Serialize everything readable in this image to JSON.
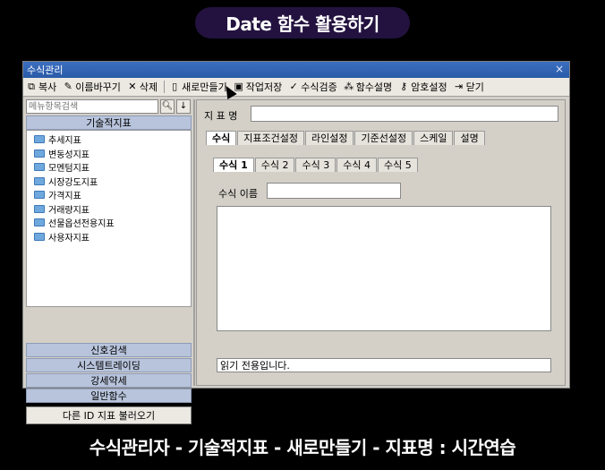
{
  "video": {
    "title": "Date 함수 활용하기",
    "caption": "수식관리자 - 기술적지표 - 새로만들기 - 지표명 : 시간연습"
  },
  "window": {
    "title": "수식관리",
    "close_glyph": "×"
  },
  "toolbar": {
    "items": [
      {
        "label": "복사",
        "icon": "copy-icon"
      },
      {
        "label": "이름바꾸기",
        "icon": "rename-icon"
      },
      {
        "label": "삭제",
        "icon": "delete-icon"
      },
      {
        "label": "새로만들기",
        "icon": "new-doc-icon"
      },
      {
        "label": "작업저장",
        "icon": "save-icon"
      },
      {
        "label": "수식검증",
        "icon": "check-icon"
      },
      {
        "label": "함수설명",
        "icon": "wand-icon"
      },
      {
        "label": "암호설정",
        "icon": "key-icon"
      },
      {
        "label": "닫기",
        "icon": "exit-icon"
      }
    ]
  },
  "left": {
    "search_placeholder": "메뉴항목검색",
    "category": "기술적지표",
    "tree": [
      "추세지표",
      "변동성지표",
      "모멘텀지표",
      "시장강도지표",
      "가격지표",
      "거래량지표",
      "선물옵션전용지표",
      "사용자지표"
    ],
    "groups": [
      "신호검색",
      "시스템트레이딩",
      "강세약세",
      "일반함수"
    ],
    "load_button": "다른 ID 지표 불러오기"
  },
  "right": {
    "name_label": "지 표 명",
    "name_value": "",
    "tabs": [
      "수식",
      "지표조건설정",
      "라인설정",
      "기준선설정",
      "스케일",
      "설명"
    ],
    "formula_tabs": [
      "수식 1",
      "수식 2",
      "수식 3",
      "수식 4",
      "수식 5"
    ],
    "formula_name_label": "수식 이름",
    "formula_name_value": "",
    "status": "읽기 전용입니다."
  }
}
